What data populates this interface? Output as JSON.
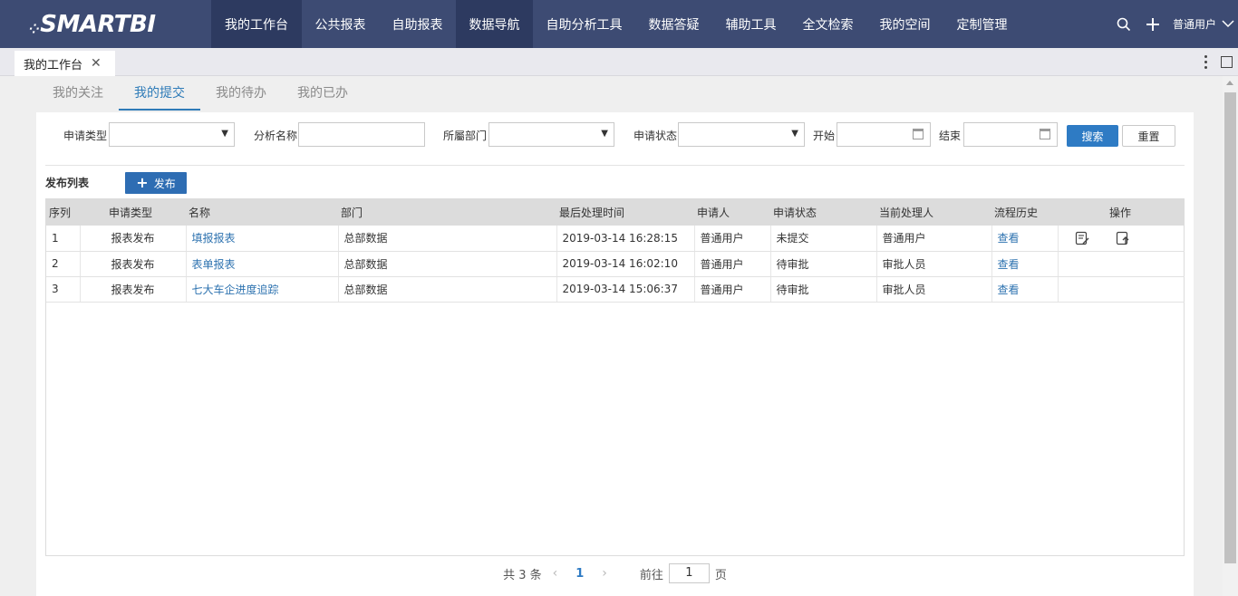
{
  "app": {
    "logo_text": "SMARTBI",
    "nav": [
      {
        "label": "我的工作台"
      },
      {
        "label": "公共报表"
      },
      {
        "label": "自助报表"
      },
      {
        "label": "数据导航"
      },
      {
        "label": "自助分析工具"
      },
      {
        "label": "数据答疑"
      },
      {
        "label": "辅助工具"
      },
      {
        "label": "全文检索"
      },
      {
        "label": "我的空间"
      },
      {
        "label": "定制管理"
      }
    ],
    "user_name": "普通用户"
  },
  "tabbar": {
    "active_tab": "我的工作台"
  },
  "subtabs": [
    {
      "label": "我的关注"
    },
    {
      "label": "我的提交"
    },
    {
      "label": "我的待办"
    },
    {
      "label": "我的已办"
    }
  ],
  "filters": {
    "apply_type_label": "申请类型",
    "apply_type_value": "",
    "analysis_name_label": "分析名称",
    "analysis_name_value": "",
    "department_label": "所屬部门",
    "department_value": "",
    "apply_status_label": "申请状态",
    "apply_status_value": "",
    "start_label": "开始",
    "start_value": "",
    "end_label": "结束",
    "end_value": "",
    "search_label": "搜索",
    "reset_label": "重置"
  },
  "list": {
    "title": "发布列表",
    "publish_label": "发布",
    "columns": [
      "序列",
      "申请类型",
      "名称",
      "部门",
      "最后处理时间",
      "申请人",
      "申请状态",
      "当前处理人",
      "流程历史",
      "操作"
    ],
    "rows": [
      {
        "index": "1",
        "type": "报表发布",
        "name": "填报报表",
        "dept": "总部数据",
        "time": "2019-03-14 16:28:15",
        "applicant": "普通用户",
        "status": "未提交",
        "handler": "普通用户",
        "history": "查看"
      },
      {
        "index": "2",
        "type": "报表发布",
        "name": "表单报表",
        "dept": "总部数据",
        "time": "2019-03-14 16:02:10",
        "applicant": "普通用户",
        "status": "待审批",
        "handler": "审批人员",
        "history": "查看"
      },
      {
        "index": "3",
        "type": "报表发布",
        "name": "七大车企进度追踪",
        "dept": "总部数据",
        "time": "2019-03-14 15:06:37",
        "applicant": "普通用户",
        "status": "待审批",
        "handler": "审批人员",
        "history": "查看"
      }
    ]
  },
  "pager": {
    "total_text": "共 3 条",
    "current_page": "1",
    "goto_label": "前往",
    "goto_value": "1",
    "page_suffix": "页"
  }
}
